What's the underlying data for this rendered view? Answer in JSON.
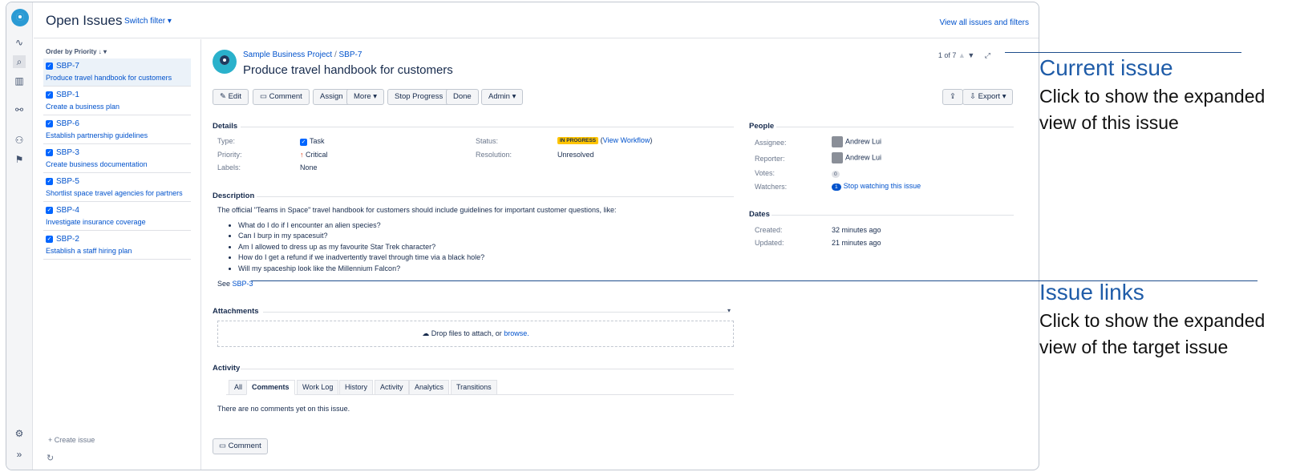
{
  "topbar": {
    "title": "Open Issues",
    "switch_filter": "Switch filter ▾",
    "view_all": "View all issues and filters"
  },
  "list": {
    "order": "Order by Priority ↓  ▾",
    "create": "+ Create issue",
    "items": [
      {
        "key": "SBP-7",
        "summary": "Produce travel handbook for customers"
      },
      {
        "key": "SBP-1",
        "summary": "Create a business plan"
      },
      {
        "key": "SBP-6",
        "summary": "Establish partnership guidelines"
      },
      {
        "key": "SBP-3",
        "summary": "Create business documentation"
      },
      {
        "key": "SBP-5",
        "summary": "Shortlist space travel agencies for partners"
      },
      {
        "key": "SBP-4",
        "summary": "Investigate insurance coverage"
      },
      {
        "key": "SBP-2",
        "summary": "Establish a staff hiring plan"
      }
    ]
  },
  "issue": {
    "project": "Sample Business Project",
    "key": "SBP-7",
    "title": "Produce travel handbook for customers",
    "pager": "1 of 7"
  },
  "toolbar": {
    "edit": "✎ Edit",
    "comment": "Comment",
    "assign": "Assign",
    "more": "More ▾",
    "stop": "Stop Progress",
    "done": "Done",
    "admin": "Admin ▾",
    "share": "⇪",
    "export": "Export ▾"
  },
  "details": {
    "heading": "Details",
    "type_label": "Type:",
    "type": "Task",
    "priority_label": "Priority:",
    "priority": "Critical",
    "labels_label": "Labels:",
    "labels": "None",
    "status_label": "Status:",
    "status": "IN PROGRESS",
    "workflow": "View Workflow",
    "resolution_label": "Resolution:",
    "resolution": "Unresolved"
  },
  "people": {
    "heading": "People",
    "assignee_label": "Assignee:",
    "assignee": "Andrew Lui",
    "reporter_label": "Reporter:",
    "reporter": "Andrew Lui",
    "votes_label": "Votes:",
    "votes": "0",
    "watchers_label": "Watchers:",
    "watchers_count": "1",
    "watch_link": "Stop watching this issue"
  },
  "dates": {
    "heading": "Dates",
    "created_label": "Created:",
    "created": "32 minutes ago",
    "updated_label": "Updated:",
    "updated": "21 minutes ago"
  },
  "description": {
    "heading": "Description",
    "text": "The official \"Teams in Space\" travel handbook for customers should include guidelines for important customer questions, like:",
    "bullets": [
      "What do I do if I encounter an alien species?",
      "Can I burp in my spacesuit?",
      "Am I allowed to dress up as my favourite Star Trek character?",
      "How do I get a refund if we inadvertently travel through time via a black hole?",
      "Will my spaceship look like the Millennium Falcon?"
    ],
    "see": "See",
    "see_link": "SBP-3"
  },
  "attachments": {
    "heading": "Attachments",
    "drop": "Drop files to attach, or",
    "browse": "browse."
  },
  "activity": {
    "heading": "Activity",
    "tabs": [
      "All",
      "Comments",
      "Work Log",
      "History",
      "Activity",
      "Analytics",
      "Transitions"
    ],
    "empty": "There are no comments yet on this issue.",
    "comment_button": "Comment"
  },
  "callouts": [
    {
      "heading": "Current issue",
      "text": "Click to show the expanded view of this issue"
    },
    {
      "heading": "Issue links",
      "text": "Click to show the expanded view of the target issue"
    }
  ]
}
